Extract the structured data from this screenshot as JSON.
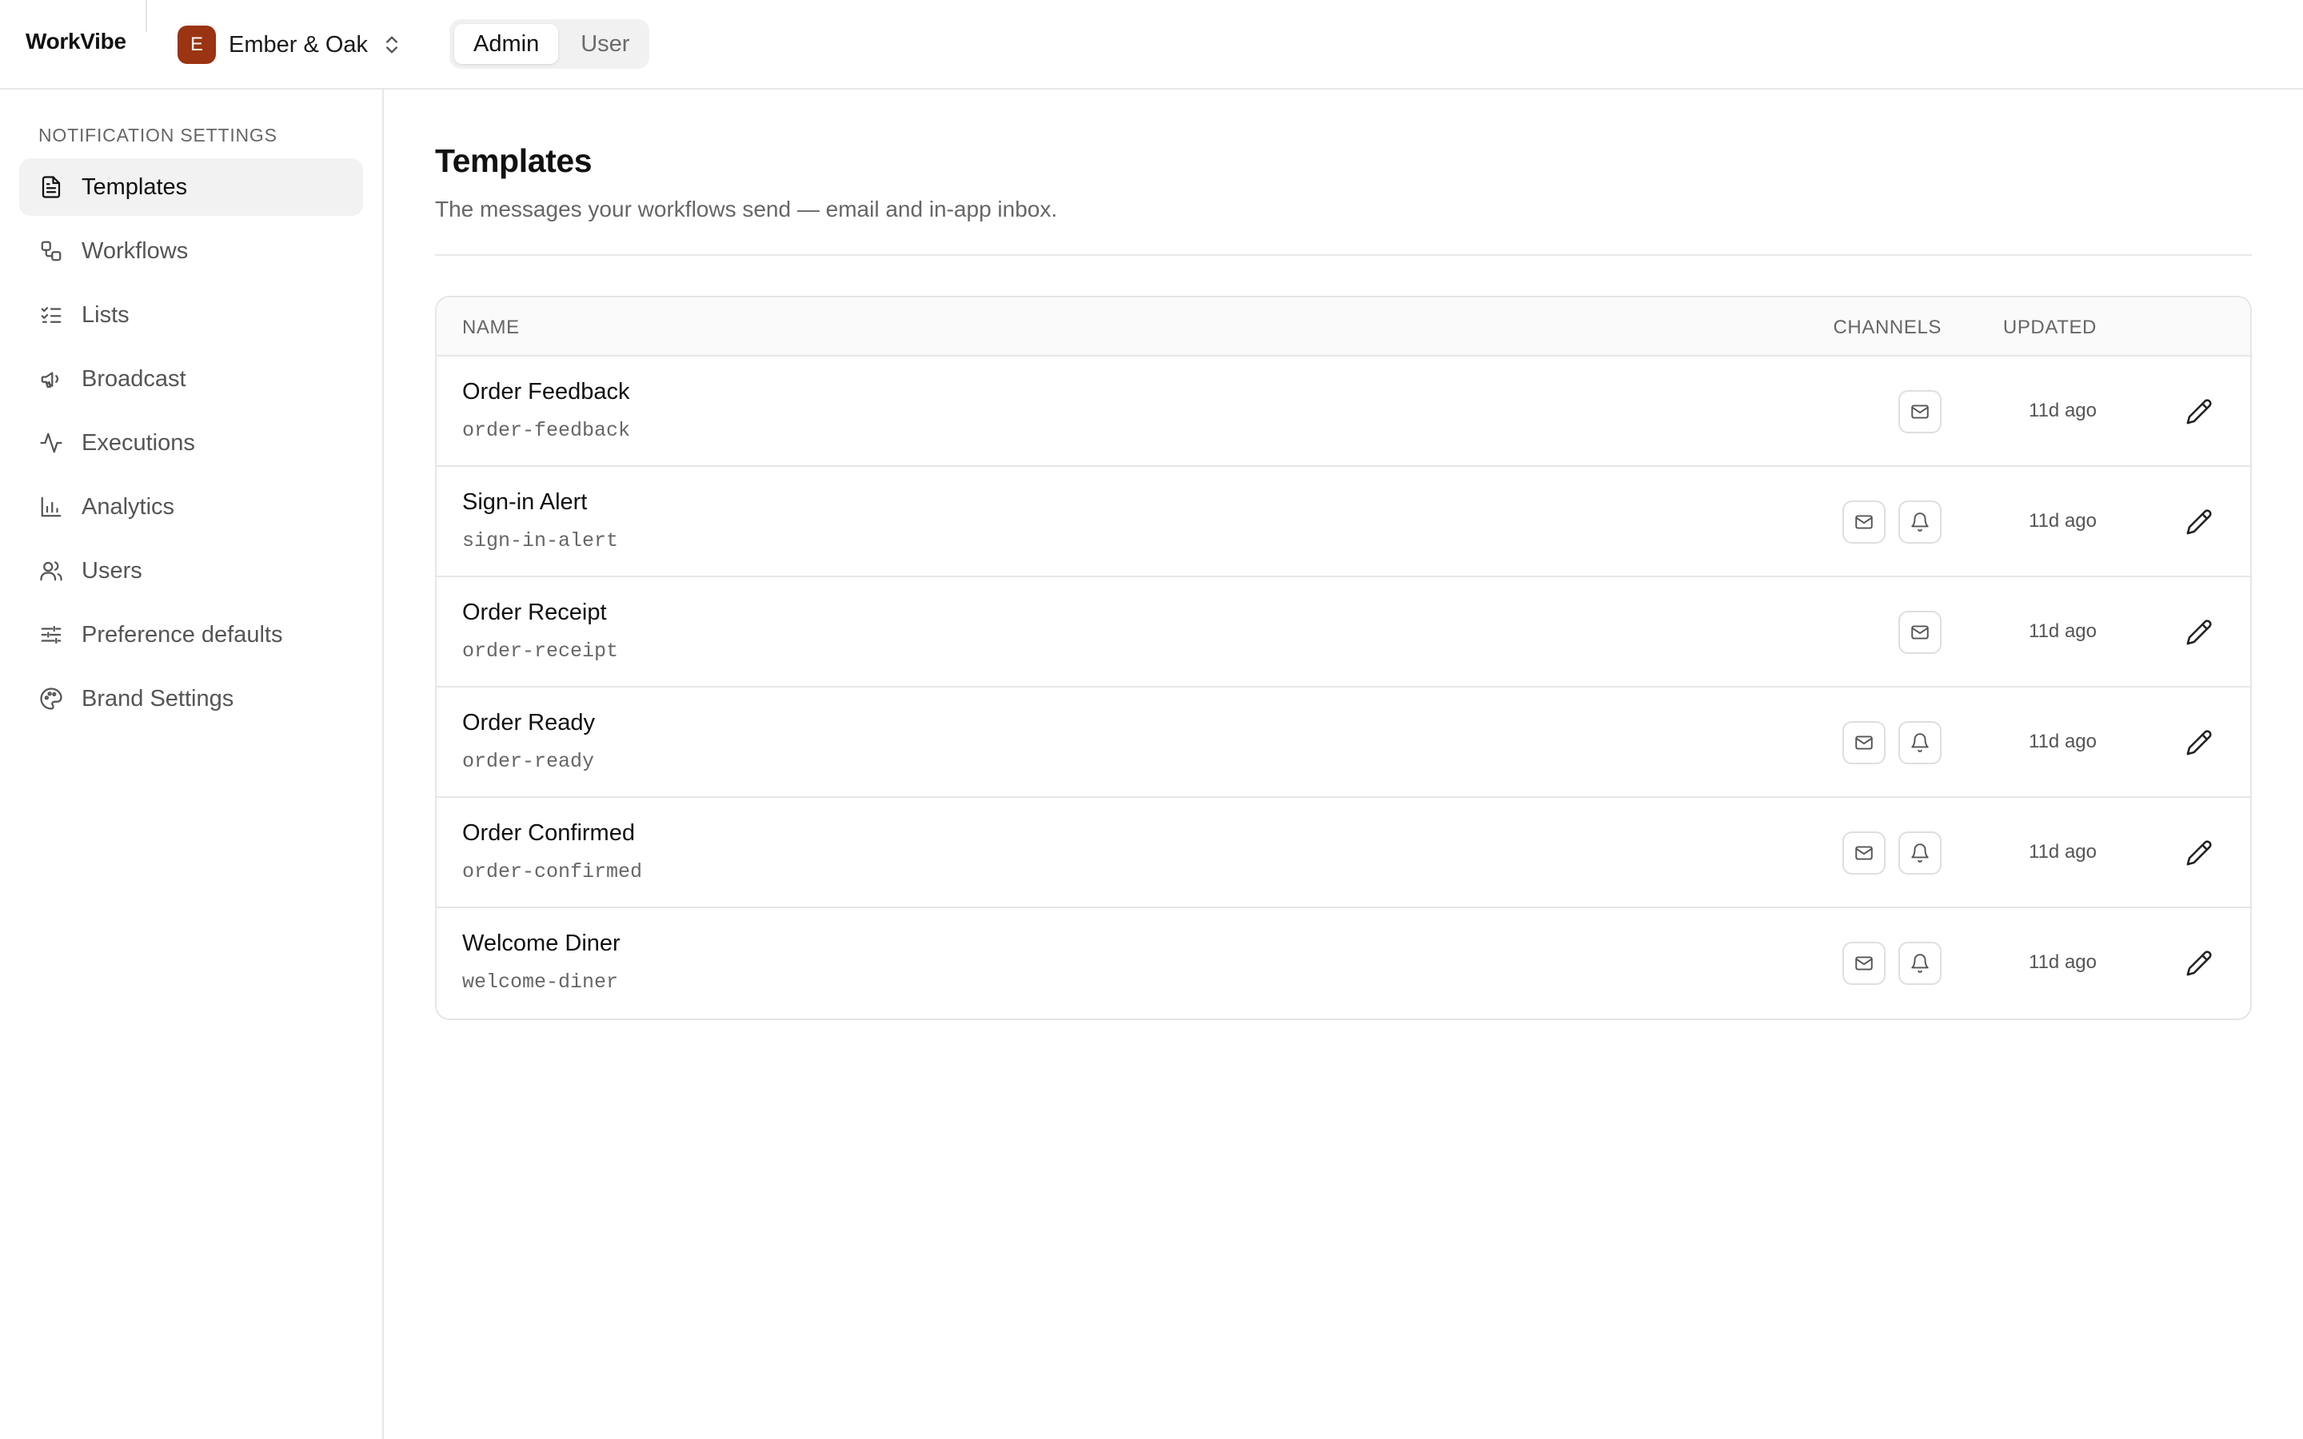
{
  "app": {
    "brand": "WorkVibe"
  },
  "org": {
    "initial": "E",
    "name": "Ember & Oak",
    "color": "#9a3412"
  },
  "role_toggle": {
    "options": [
      "Admin",
      "User"
    ],
    "active": "Admin"
  },
  "sidebar": {
    "section_title": "NOTIFICATION SETTINGS",
    "items": [
      {
        "label": "Templates",
        "icon": "file-text-icon",
        "active": true
      },
      {
        "label": "Workflows",
        "icon": "workflow-icon",
        "active": false
      },
      {
        "label": "Lists",
        "icon": "list-checks-icon",
        "active": false
      },
      {
        "label": "Broadcast",
        "icon": "megaphone-icon",
        "active": false
      },
      {
        "label": "Executions",
        "icon": "activity-icon",
        "active": false
      },
      {
        "label": "Analytics",
        "icon": "bar-chart-icon",
        "active": false
      },
      {
        "label": "Users",
        "icon": "users-icon",
        "active": false
      },
      {
        "label": "Preference defaults",
        "icon": "sliders-icon",
        "active": false
      },
      {
        "label": "Brand Settings",
        "icon": "palette-icon",
        "active": false
      }
    ]
  },
  "page": {
    "title": "Templates",
    "subtitle": "The messages your workflows send — email and in-app inbox."
  },
  "table": {
    "headers": {
      "name": "NAME",
      "channels": "CHANNELS",
      "updated": "UPDATED"
    },
    "rows": [
      {
        "name": "Order Feedback",
        "slug": "order-feedback",
        "channels": [
          "email"
        ],
        "updated": "11d ago"
      },
      {
        "name": "Sign-in Alert",
        "slug": "sign-in-alert",
        "channels": [
          "email",
          "in-app"
        ],
        "updated": "11d ago"
      },
      {
        "name": "Order Receipt",
        "slug": "order-receipt",
        "channels": [
          "email"
        ],
        "updated": "11d ago"
      },
      {
        "name": "Order Ready",
        "slug": "order-ready",
        "channels": [
          "email",
          "in-app"
        ],
        "updated": "11d ago"
      },
      {
        "name": "Order Confirmed",
        "slug": "order-confirmed",
        "channels": [
          "email",
          "in-app"
        ],
        "updated": "11d ago"
      },
      {
        "name": "Welcome Diner",
        "slug": "welcome-diner",
        "channels": [
          "email",
          "in-app"
        ],
        "updated": "11d ago"
      }
    ]
  }
}
